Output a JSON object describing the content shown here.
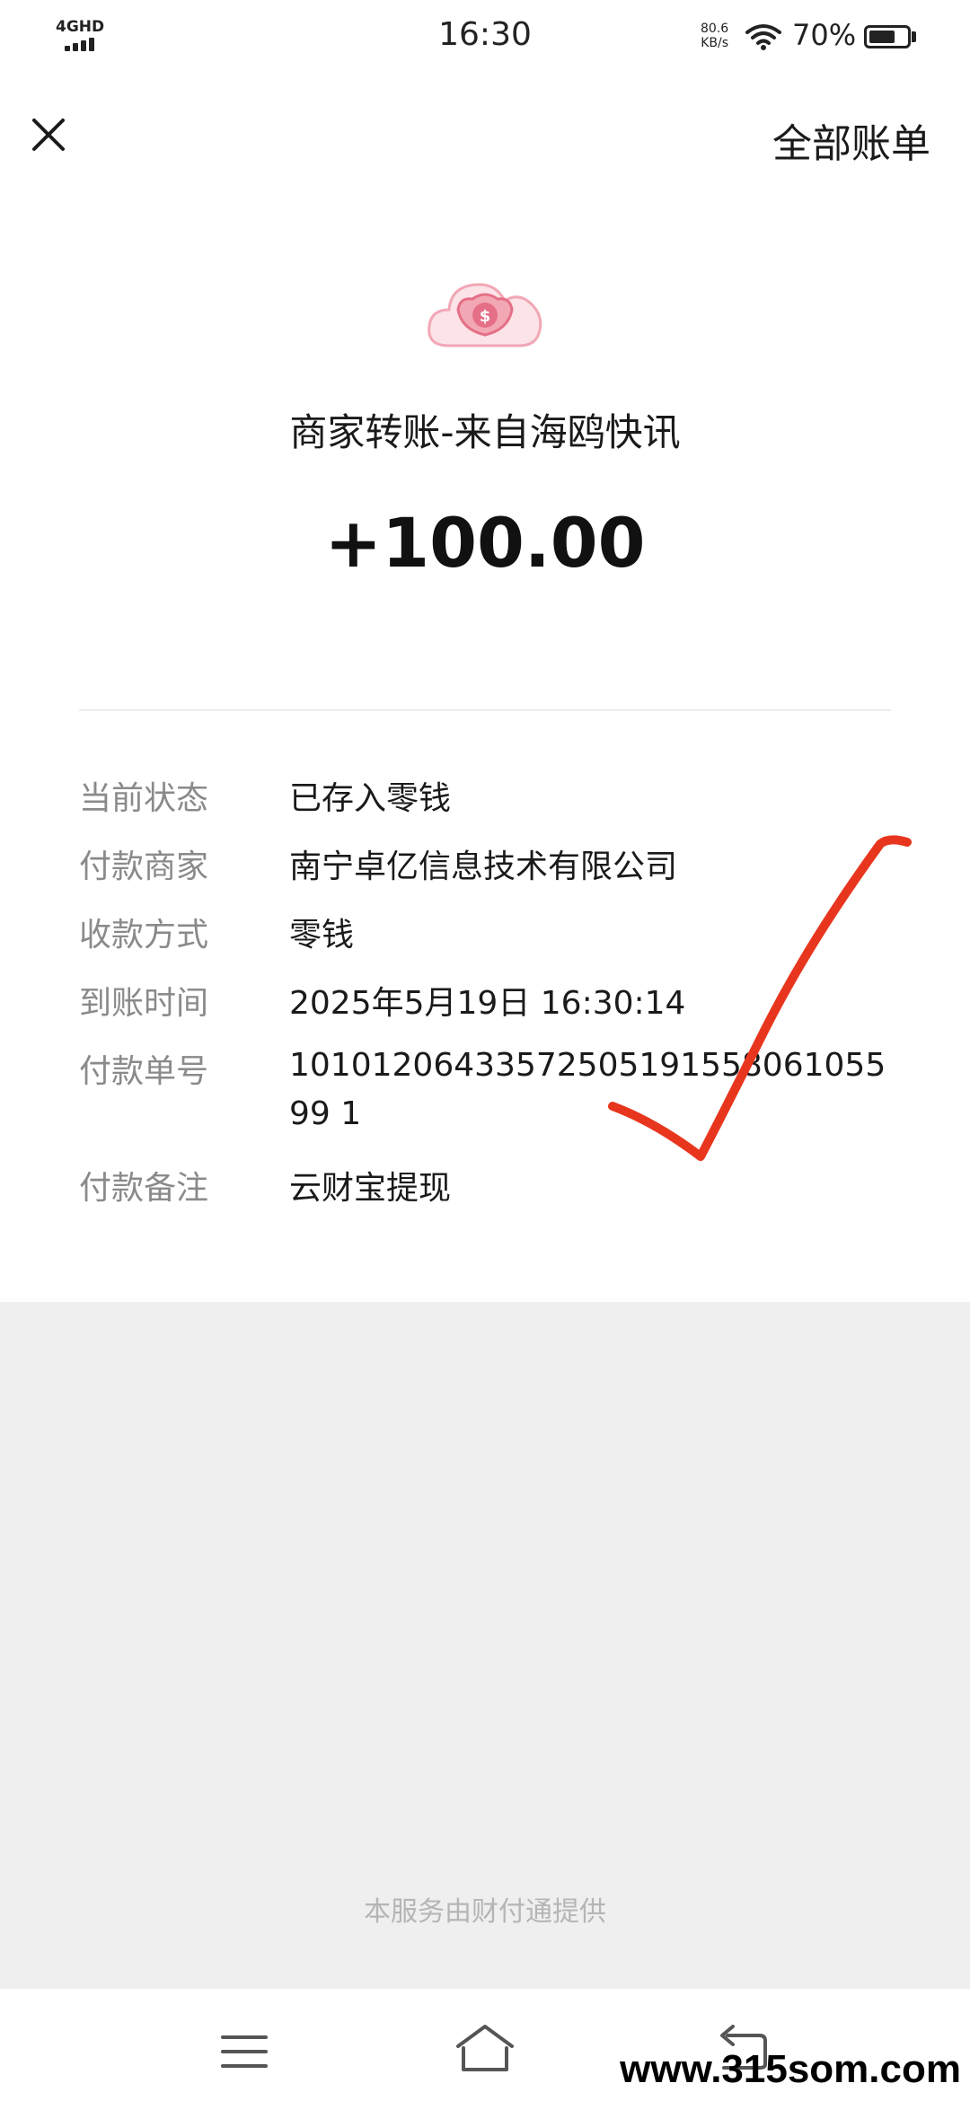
{
  "status_bar": {
    "network": "4GHD",
    "time": "16:30",
    "speed_value": "80.6",
    "speed_unit": "KB/s",
    "battery": "70%",
    "battery_level": 0.7
  },
  "header": {
    "all_bills_label": "全部账单"
  },
  "transfer": {
    "title": "商家转账-来自海鸥快讯",
    "amount": "+100.00"
  },
  "details": [
    {
      "label": "当前状态",
      "value": "已存入零钱"
    },
    {
      "label": "付款商家",
      "value": "南宁卓亿信息技术有限公司"
    },
    {
      "label": "收款方式",
      "value": "零钱"
    },
    {
      "label": "到账时间",
      "value": "2025年5月19日 16:30:14"
    },
    {
      "label": "付款单号",
      "value": "1010120643357250519155806105599 1"
    },
    {
      "label": "付款备注",
      "value": "云财宝提现"
    }
  ],
  "footer": {
    "provider": "本服务由财付通提供"
  },
  "watermark": "www.315som.com",
  "colors": {
    "icon_pink": "#f2a7b5",
    "icon_dark_pink": "#e56f86",
    "check_red": "#e8361e"
  }
}
